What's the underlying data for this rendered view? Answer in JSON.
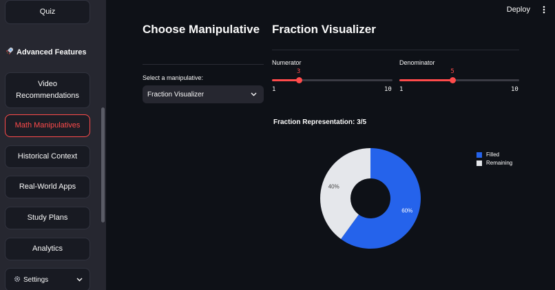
{
  "sidebar": {
    "quiz_label": "Quiz",
    "section_icon": "rocket-icon",
    "section_title": "Advanced Features",
    "items": [
      {
        "label": "Video\nRecommendations"
      },
      {
        "label": "Math Manipulatives",
        "active": true
      },
      {
        "label": "Historical Context"
      },
      {
        "label": "Real-World Apps"
      },
      {
        "label": "Study Plans"
      },
      {
        "label": "Analytics"
      }
    ],
    "settings_label": "Settings",
    "settings_icon": "gear-icon"
  },
  "topbar": {
    "deploy_label": "Deploy",
    "menu_icon": "kebab-menu-icon"
  },
  "main": {
    "left_heading": "Choose Manipulative",
    "right_heading": "Fraction Visualizer",
    "select_label": "Select a manipulative:",
    "select_value": "Fraction Visualizer",
    "numerator": {
      "label": "Numerator",
      "value": 3,
      "min": 1,
      "max": 10,
      "value_text": "3",
      "min_text": "1",
      "max_text": "10"
    },
    "denominator": {
      "label": "Denominator",
      "value": 5,
      "min": 1,
      "max": 10,
      "value_text": "5",
      "min_text": "1",
      "max_text": "10"
    },
    "fraction_title": "Fraction Representation: 3/5"
  },
  "colors": {
    "accent": "#ff4b4b",
    "filled": "#2563eb",
    "remaining": "#e5e7eb"
  },
  "chart_data": {
    "type": "pie",
    "donut": true,
    "categories": [
      "Filled",
      "Remaining"
    ],
    "values": [
      60,
      40
    ],
    "labels": [
      "60%",
      "40%"
    ],
    "legend": [
      "Filled",
      "Remaining"
    ],
    "legend_position": "top-right"
  }
}
